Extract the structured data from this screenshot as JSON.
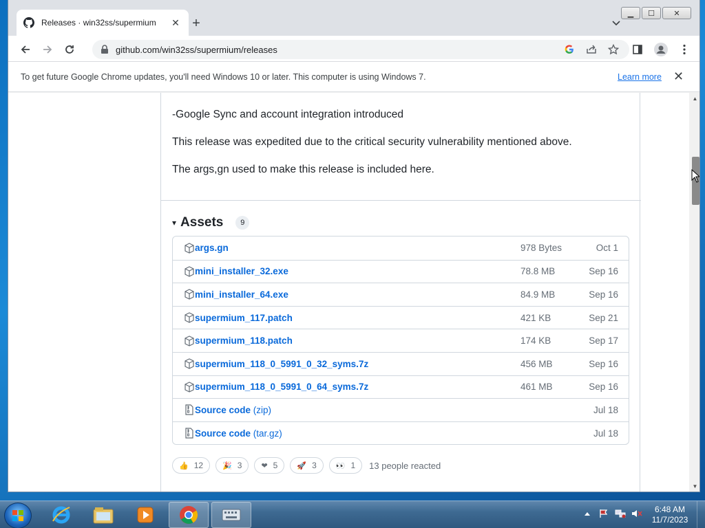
{
  "browser": {
    "tab_title": "Releases · win32ss/supermium",
    "tab_close": "✕",
    "new_tab": "+",
    "url": "github.com/win32ss/supermium/releases",
    "icons": {
      "back": "arrow-left-icon",
      "forward": "arrow-right-icon",
      "reload": "reload-icon",
      "lock": "lock-icon",
      "google": "google-icon",
      "share": "share-icon",
      "bookmark": "star-icon",
      "sidebar": "side-panel-icon",
      "profile": "profile-icon",
      "menu": "kebab-menu-icon"
    }
  },
  "window_controls": {
    "minimize": "▁",
    "maximize": "☐",
    "close": "✕"
  },
  "infobar": {
    "message": "To get future Google Chrome updates, you'll need Windows 10 or later. This computer is using Windows 7.",
    "learn_more": "Learn more",
    "close": "✕"
  },
  "release_notes": {
    "lines": [
      "-Google Sync and account integration introduced",
      "This release was expedited due to the critical security vulnerability mentioned above.",
      "The args,gn used to make this release is included here."
    ]
  },
  "assets": {
    "toggle": "▾",
    "title": "Assets",
    "count": "9",
    "items": [
      {
        "name": "args.gn",
        "suffix": "",
        "size": "978 Bytes",
        "date": "Oct 1",
        "icon": "package-icon"
      },
      {
        "name": "mini_installer_32.exe",
        "suffix": "",
        "size": "78.8 MB",
        "date": "Sep 16",
        "icon": "package-icon"
      },
      {
        "name": "mini_installer_64.exe",
        "suffix": "",
        "size": "84.9 MB",
        "date": "Sep 16",
        "icon": "package-icon"
      },
      {
        "name": "supermium_117.patch",
        "suffix": "",
        "size": "421 KB",
        "date": "Sep 21",
        "icon": "package-icon"
      },
      {
        "name": "supermium_118.patch",
        "suffix": "",
        "size": "174 KB",
        "date": "Sep 17",
        "icon": "package-icon"
      },
      {
        "name": "supermium_118_0_5991_0_32_syms.7z",
        "suffix": "",
        "size": "456 MB",
        "date": "Sep 16",
        "icon": "package-icon"
      },
      {
        "name": "supermium_118_0_5991_0_64_syms.7z",
        "suffix": "",
        "size": "461 MB",
        "date": "Sep 16",
        "icon": "package-icon"
      },
      {
        "name": "Source code",
        "suffix": " (zip)",
        "size": "",
        "date": "Jul 18",
        "icon": "file-zip-icon"
      },
      {
        "name": "Source code",
        "suffix": " (tar.gz)",
        "size": "",
        "date": "Jul 18",
        "icon": "file-zip-icon"
      }
    ]
  },
  "reactions": {
    "items": [
      {
        "emoji": "👍",
        "count": "12",
        "icon": "thumbs-up-icon"
      },
      {
        "emoji": "🎉",
        "count": "3",
        "icon": "hooray-icon"
      },
      {
        "emoji": "❤",
        "count": "5",
        "icon": "heart-icon"
      },
      {
        "emoji": "🚀",
        "count": "3",
        "icon": "rocket-icon"
      },
      {
        "emoji": "👀",
        "count": "1",
        "icon": "eyes-icon"
      }
    ],
    "summary": "13 people reacted"
  },
  "taskbar": {
    "apps": [
      "internet-explorer-icon",
      "file-explorer-icon",
      "media-player-icon",
      "chrome-icon",
      "on-screen-keyboard-icon"
    ],
    "clock_time": "6:48 AM",
    "clock_date": "11/7/2023"
  },
  "colors": {
    "link": "#0969da",
    "muted": "#656d76",
    "border": "#d0d7de",
    "chrome_blue": "#1a73e8"
  }
}
